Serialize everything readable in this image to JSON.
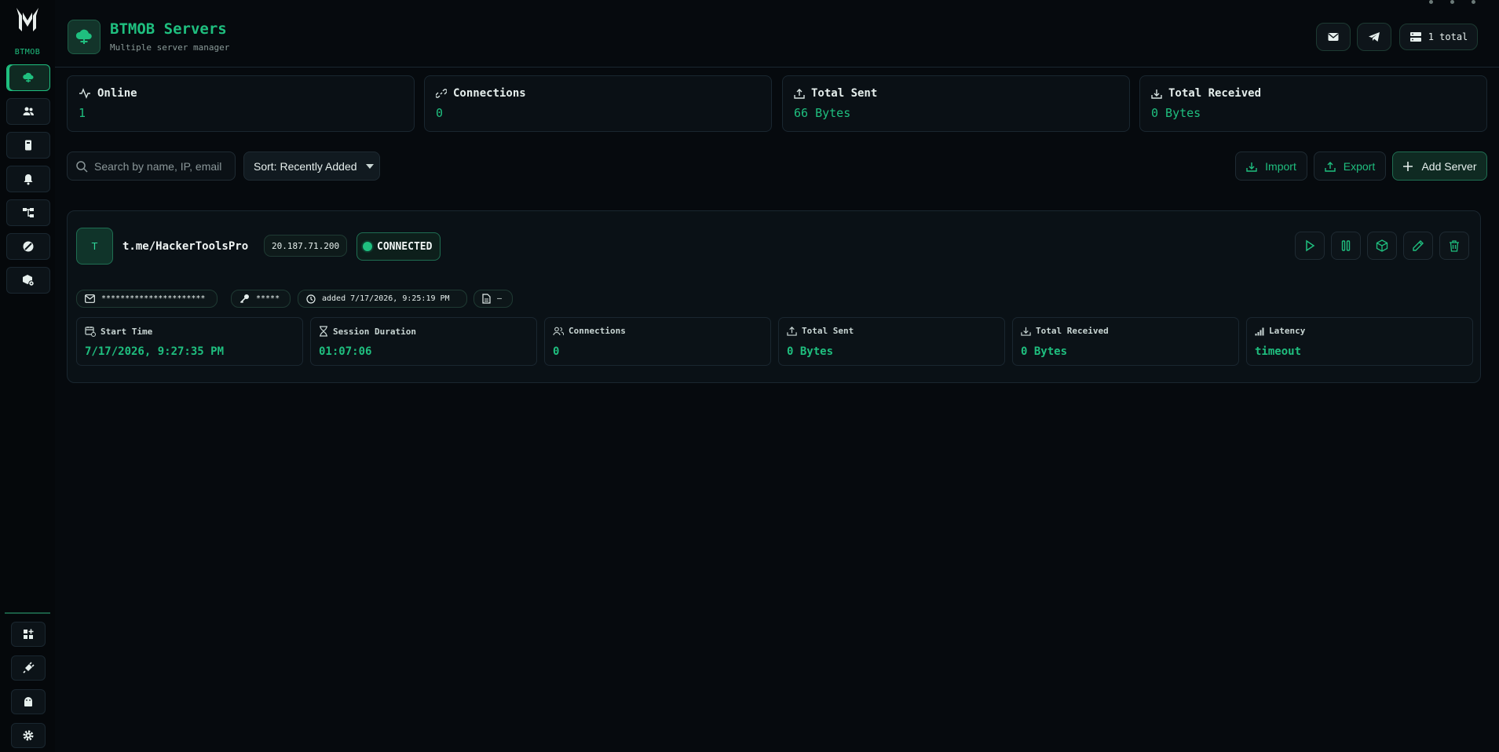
{
  "sidebar": {
    "brand": "BTMOB"
  },
  "header": {
    "title": "BTMOB Servers",
    "subtitle": "Multiple server manager",
    "total_label": "1 total"
  },
  "stats": [
    {
      "label": "Online",
      "value": "1"
    },
    {
      "label": "Connections",
      "value": "0"
    },
    {
      "label": "Total Sent",
      "value": "66 Bytes"
    },
    {
      "label": "Total Received",
      "value": "0 Bytes"
    }
  ],
  "toolbar": {
    "search_placeholder": "Search by name, IP, email",
    "sort_label": "Sort: Recently Added",
    "import_label": "Import",
    "export_label": "Export",
    "add_label": "Add Server"
  },
  "server": {
    "avatar_letter": "T",
    "name": "t.me/HackerToolsPro",
    "ip": "20.187.71.200",
    "status": "CONNECTED",
    "email_masked": "**********************",
    "password_masked": "*****",
    "added": "added 7/17/2026, 9:25:19 PM",
    "note": "–",
    "metrics": [
      {
        "label": "Start Time",
        "value": "7/17/2026, 9:27:35 PM"
      },
      {
        "label": "Session Duration",
        "value": "01:07:06"
      },
      {
        "label": "Connections",
        "value": "0"
      },
      {
        "label": "Total Sent",
        "value": "0 Bytes"
      },
      {
        "label": "Total Received",
        "value": "0 Bytes"
      },
      {
        "label": "Latency",
        "value": "timeout"
      }
    ]
  },
  "colors": {
    "accent": "#1fbf7f",
    "background": "#060a0e",
    "panel": "#0a1015"
  }
}
